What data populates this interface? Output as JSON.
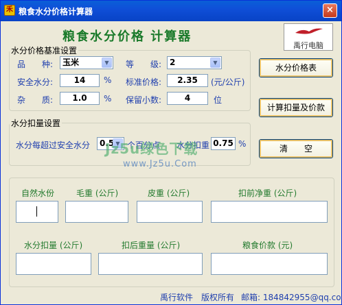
{
  "window": {
    "title": "粮食水分价格计算器",
    "close": "×"
  },
  "app_icon": "禾",
  "heading": "粮食水分价格 计算器",
  "logo": {
    "text": "禹行电脑"
  },
  "base": {
    "legend": "水分价格基准设置",
    "variety_label": "品　　种:",
    "variety_value": "玉米",
    "grade_label": "等　　级:",
    "grade_value": "2",
    "safe_moisture_label": "安全水分:",
    "safe_moisture_value": "14",
    "safe_moisture_unit": "%",
    "std_price_label": "标准价格:",
    "std_price_value": "2.35",
    "std_price_unit": "(元/公斤)",
    "impurity_label": "杂　　质:",
    "impurity_value": "1.0",
    "impurity_unit": "%",
    "decimals_label": "保留小数:",
    "decimals_value": "4",
    "decimals_unit": "位"
  },
  "deduct": {
    "legend": "水分扣量设置",
    "over_label": "水分每超过安全水分",
    "over_value": "0.5",
    "per_unit_label": "个百分点",
    "deduct_label": "水分扣重",
    "deduct_value": "0.75",
    "deduct_unit": "%"
  },
  "buttons": {
    "price_table": "水分价格表",
    "calculate": "计算扣量及价款",
    "clear": "清　　空"
  },
  "watermark": {
    "line1": "Jz5u绿色下载",
    "line2": "www.Jz5u.Com"
  },
  "results": {
    "natural_moisture": "自然水份",
    "gross_weight": "毛重 (公斤)",
    "tare_weight": "皮重 (公斤)",
    "pre_net_weight": "扣前净重 (公斤)",
    "moisture_deduction": "水分扣量 (公斤)",
    "post_weight": "扣后重量 (公斤)",
    "grain_payment": "粮食价款 (元)"
  },
  "footer": {
    "company": "禹行软件　版权所有",
    "email": "邮箱: 184842955@qq.com"
  },
  "colors": {
    "title_bar": "#0a5fd7",
    "heading": "#1a7a2a",
    "label_blue": "#1f3fae"
  }
}
